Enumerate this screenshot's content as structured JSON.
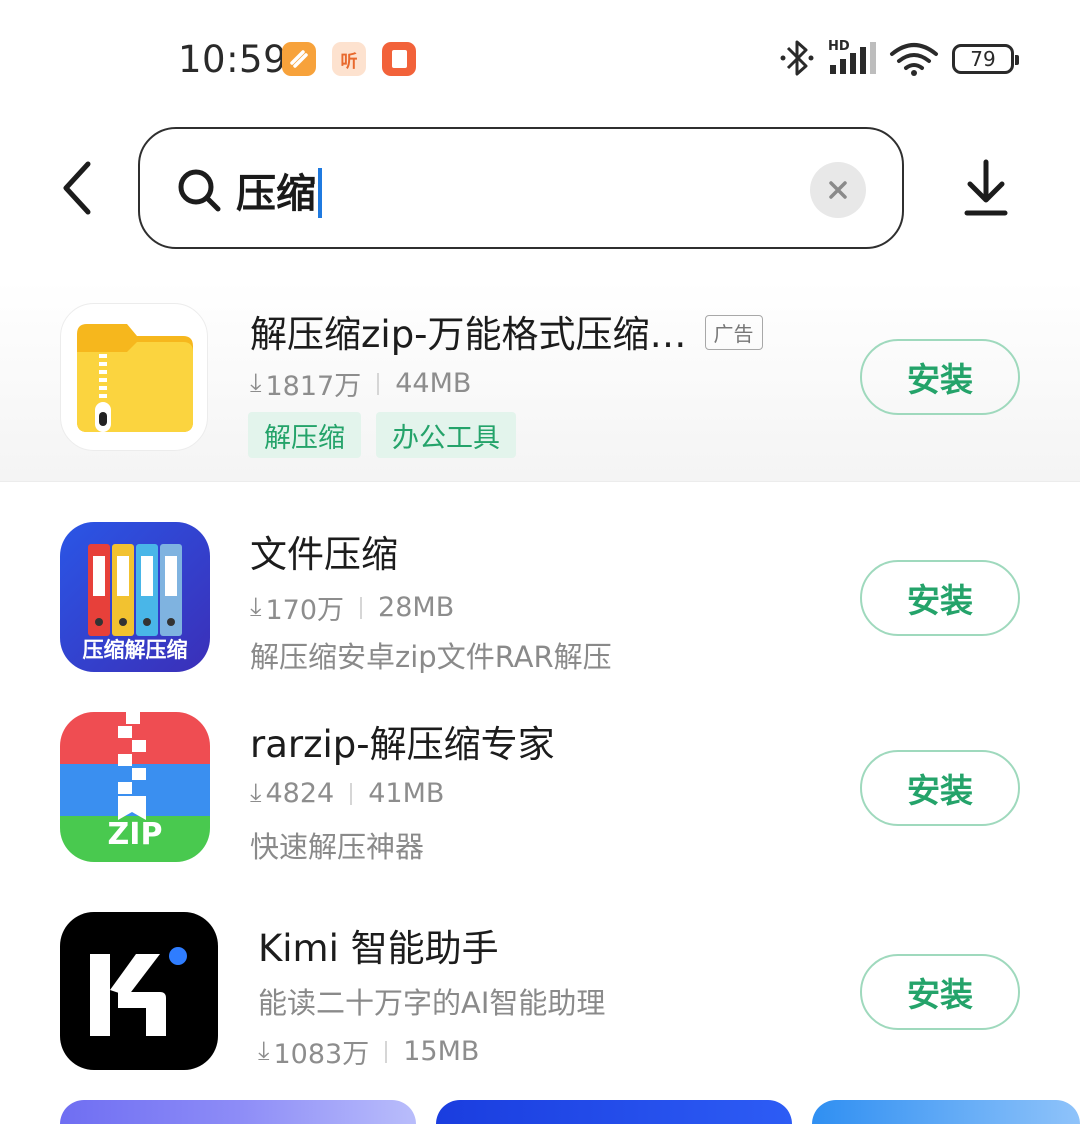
{
  "status_bar": {
    "time": "10:59",
    "notif_listen": "听",
    "battery": "79",
    "network_label": "HD"
  },
  "search": {
    "query": "压缩"
  },
  "apps": [
    {
      "name": "解压缩zip-万能格式压缩…",
      "ad_tag": "广告",
      "downloads": "1817万",
      "size": "44MB",
      "tags": [
        "解压缩",
        "办公工具"
      ],
      "install": "安装"
    },
    {
      "name": "文件压缩",
      "downloads": "170万",
      "size": "28MB",
      "desc": "解压缩安卓zip文件RAR解压",
      "icon_text": "压缩解压缩",
      "install": "安装"
    },
    {
      "name": "rarzip-解压缩专家",
      "downloads": "4824",
      "size": "41MB",
      "desc": "快速解压神器",
      "icon_text": "ZIP",
      "install": "安装"
    },
    {
      "name": "Kimi 智能助手",
      "desc": "能读二十万字的AI智能助理",
      "downloads": "1083万",
      "size": "15MB",
      "install": "安装"
    }
  ],
  "colors": {
    "install_green": "#24a36a",
    "tag_bg": "#e3f4ec"
  }
}
